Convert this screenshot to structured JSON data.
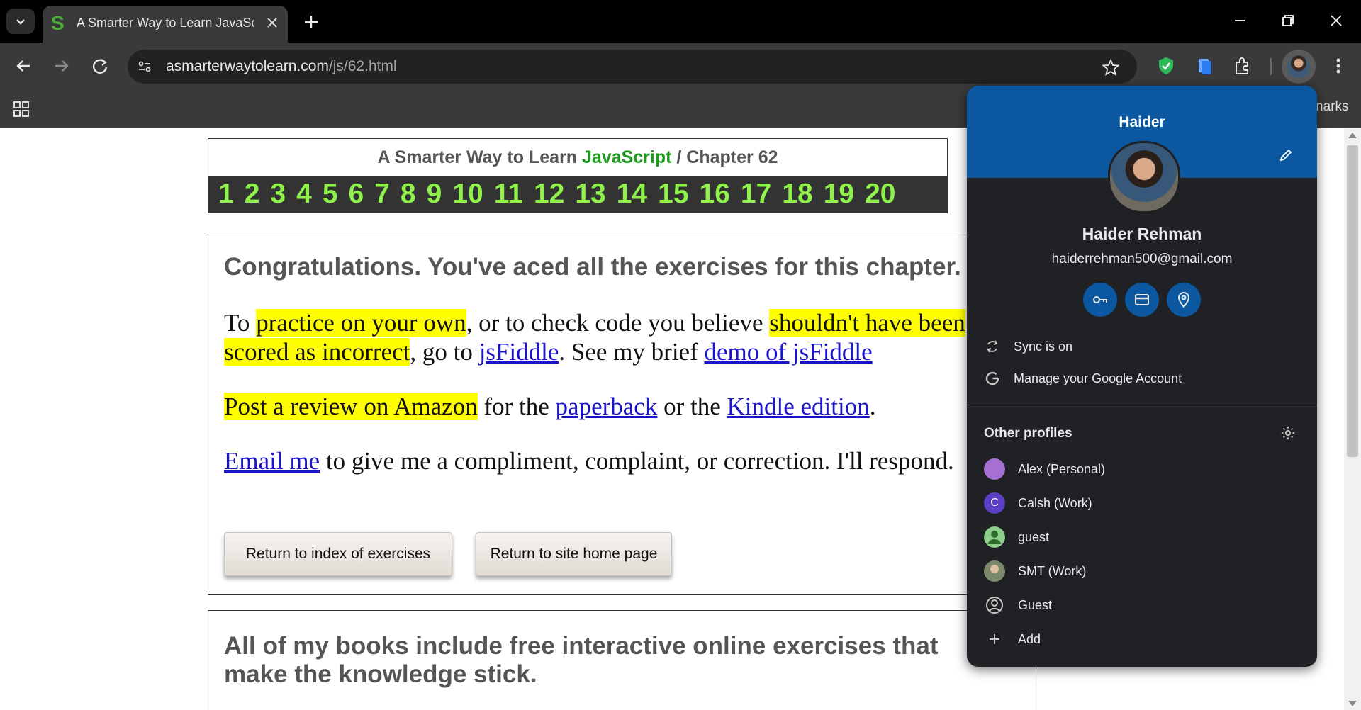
{
  "browser": {
    "tab_title": "A Smarter Way to Learn JavaScr",
    "tab_favicon": "S",
    "url_host": "asmarterwaytolearn.com",
    "url_path": "/js/62.html",
    "bookmarks_text": "narks"
  },
  "page": {
    "header_prefix": "A Smarter Way to Learn ",
    "header_js": "JavaScript",
    "header_suffix": "  /  Chapter 62",
    "chapters": [
      "1",
      "2",
      "3",
      "4",
      "5",
      "6",
      "7",
      "8",
      "9",
      "10",
      "11",
      "12",
      "13",
      "14",
      "15",
      "16",
      "17",
      "18",
      "19",
      "20"
    ],
    "congrats": "Congratulations. You've aced all the exercises for this chapter.",
    "p1": {
      "t1": "To ",
      "h1": "practice on your own",
      "t2": ", or to check code you believe ",
      "h2": "shouldn't have been scored as incorrect",
      "t3": ", go to ",
      "l1": "jsFiddle",
      "t4": ". See my brief ",
      "l2": "demo of jsFiddle"
    },
    "p2": {
      "h1": "Post a review on Amazon",
      "t1": " for the ",
      "l1": "paperback",
      "t2": " or the ",
      "l2": "Kindle edition",
      "t3": "."
    },
    "p3": {
      "l1": "Email me",
      "t1": " to give me a compliment, complaint, or correction. I'll respond."
    },
    "btn_index": "Return to index of exercises",
    "btn_home": "Return to site home page",
    "bottom_text": "All of my books include free interactive online exercises that make the knowledge stick."
  },
  "profile_menu": {
    "name_top": "Haider",
    "full_name": "Haider Rehman",
    "email": "haiderrehman500@gmail.com",
    "quick_actions": [
      "key-icon",
      "credit-card-icon",
      "location-pin-icon"
    ],
    "sync": "Sync is on",
    "manage": "Manage your Google Account",
    "other_profiles_title": "Other profiles",
    "profiles": [
      {
        "label": "Alex (Personal)",
        "avatar_color": "#a66fd4"
      },
      {
        "label": "Calsh (Work)",
        "avatar_color": "#5b3fc4",
        "initial": "C"
      },
      {
        "label": "guest",
        "avatar_color": "#8ccf8a"
      },
      {
        "label": "SMT (Work)",
        "avatar_color": "#7a8a6a"
      },
      {
        "label": "Guest"
      },
      {
        "label": "Add"
      }
    ],
    "colors": {
      "banner": "#0b57a0",
      "panel": "#202124"
    }
  }
}
